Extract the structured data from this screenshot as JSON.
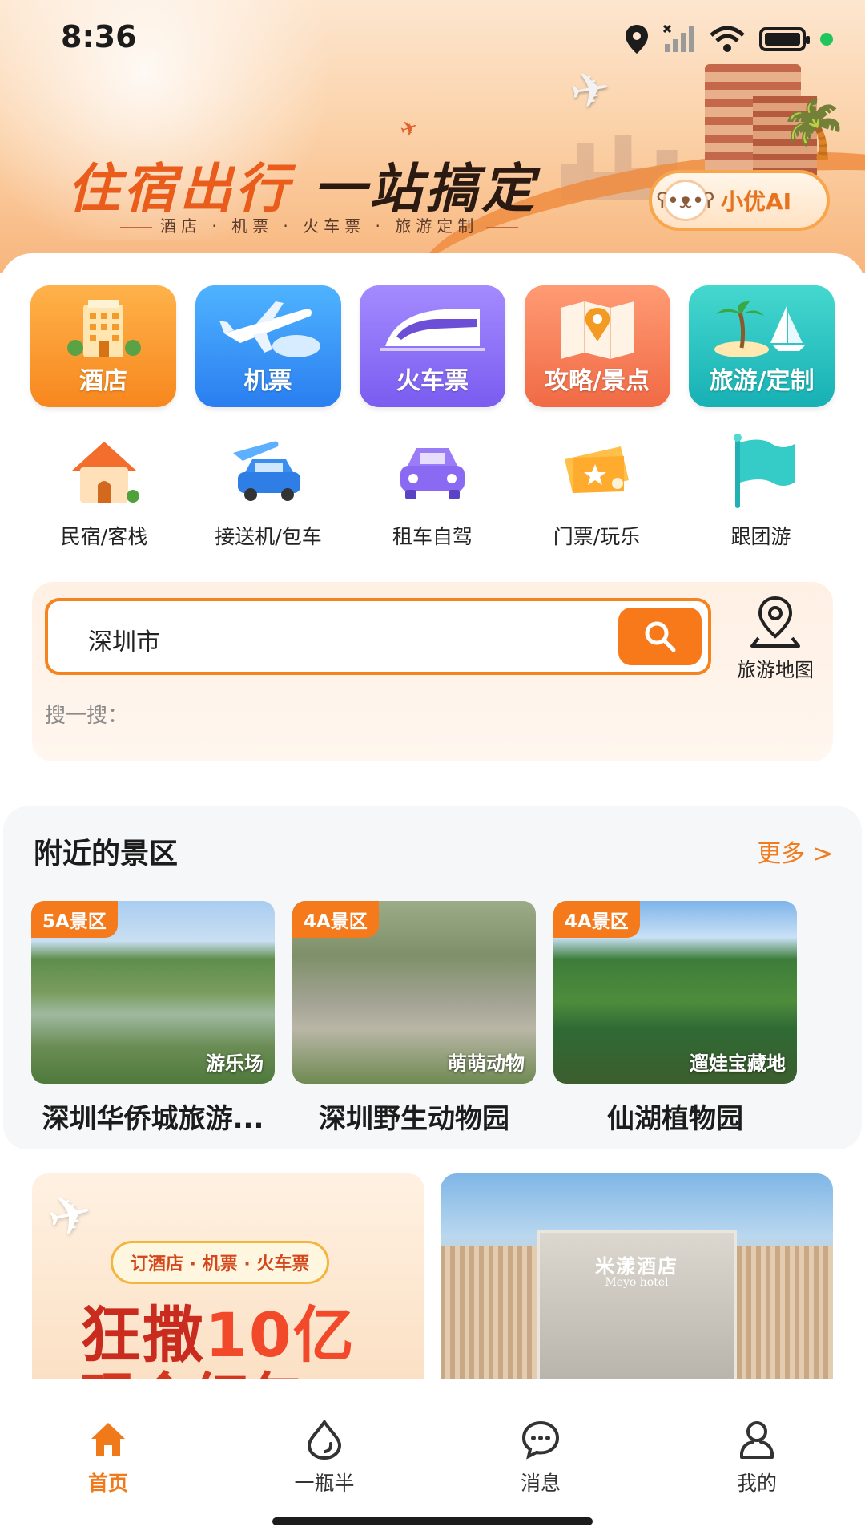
{
  "status_bar": {
    "time": "8:36",
    "icons": [
      "location-icon",
      "signal-icon",
      "wifi-icon",
      "battery-icon"
    ]
  },
  "hero": {
    "slogan_part1": "住宿出行",
    "slogan_part2": "一站搞定",
    "subline": "酒店 · 机票 · 火车票 · 旅游定制",
    "ai_button_label": "小优AI"
  },
  "categories": [
    {
      "label": "酒店",
      "icon": "hotel-icon"
    },
    {
      "label": "机票",
      "icon": "plane-icon"
    },
    {
      "label": "火车票",
      "icon": "train-icon"
    },
    {
      "label": "攻略/景点",
      "icon": "map-guide-icon"
    },
    {
      "label": "旅游/定制",
      "icon": "island-icon"
    }
  ],
  "services": [
    {
      "label": "民宿/客栈",
      "icon": "house-icon"
    },
    {
      "label": "接送机/包车",
      "icon": "car-transfer-icon"
    },
    {
      "label": "租车自驾",
      "icon": "rental-car-icon"
    },
    {
      "label": "门票/玩乐",
      "icon": "ticket-icon"
    },
    {
      "label": "跟团游",
      "icon": "flag-icon"
    }
  ],
  "search": {
    "value": "深圳市",
    "hint": "搜一搜：",
    "map_label": "旅游地图"
  },
  "nearby": {
    "title": "附近的景区",
    "more": "更多 >",
    "spots": [
      {
        "badge": "5A景区",
        "tag": "游乐场",
        "name": "深圳华侨城旅游..."
      },
      {
        "badge": "4A景区",
        "tag": "萌萌动物",
        "name": "深圳野生动物园"
      },
      {
        "badge": "4A景区",
        "tag": "遛娃宝藏地",
        "name": "仙湖植物园"
      }
    ]
  },
  "promos": {
    "left_pill": "订酒店 · 机票 · 火车票",
    "left_big_a": "狂撒",
    "left_big_num": "10亿",
    "left_big_b": "现金红包",
    "right_sign": "米漾酒店",
    "right_sign_en": "Meyo hotel"
  },
  "nav": [
    {
      "label": "首页",
      "icon": "home-icon",
      "active": true
    },
    {
      "label": "一瓶半",
      "icon": "drop-icon",
      "active": false
    },
    {
      "label": "消息",
      "icon": "message-icon",
      "active": false
    },
    {
      "label": "我的",
      "icon": "profile-icon",
      "active": false
    }
  ],
  "colors": {
    "accent": "#f5841f",
    "active_nav": "#f07a1a",
    "badge": "#f57a1c"
  }
}
